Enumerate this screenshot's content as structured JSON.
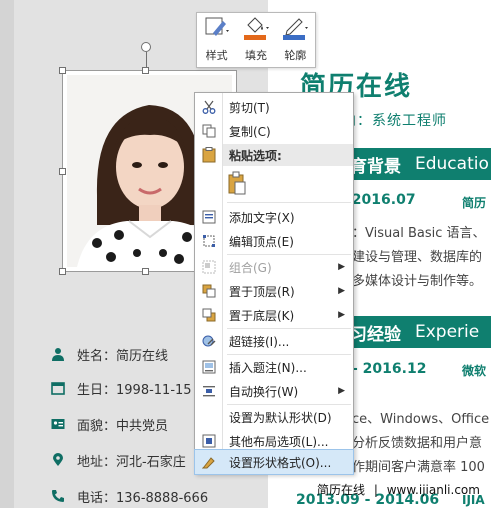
{
  "toolbar": {
    "style_label": "样式",
    "fill_label": "填充",
    "outline_label": "轮廓"
  },
  "context_menu": {
    "cut": "剪切(T)",
    "copy": "复制(C)",
    "paste_options": "粘贴选项:",
    "add_text": "添加文字(X)",
    "edit_points": "编辑顶点(E)",
    "group": "组合(G)",
    "bring_to_front": "置于顶层(R)",
    "send_to_back": "置于底层(K)",
    "hyperlink": "超链接(I)...",
    "insert_caption": "插入题注(N)...",
    "wrap_text": "自动换行(W)",
    "set_default_shape": "设置为默认形状(D)",
    "more_layout": "其他布局选项(L)...",
    "format_shape": "设置形状格式(O)..."
  },
  "resume": {
    "name": "姓名：简历在线",
    "birthday": "生日：1998-11-15",
    "politics": "面貌：中共党员",
    "address": "地址：河北-石家庄",
    "phone": "电话：136-8888-666",
    "title": "简历在线",
    "intent": "向：系统工程师",
    "edu_heading": "育背景",
    "edu_heading_en": "Educatio",
    "edu_date": "-2016.07",
    "edu_side": "简历",
    "edu_line1": "：Visual Basic 语言、",
    "edu_line2": "建设与管理、数据库的",
    "edu_line3": "多媒体设计与制作等。",
    "work_heading": "习经验",
    "work_heading_en": "Experie",
    "work_date": "- 2016.12",
    "work_side": "微软",
    "work_line1": "ce、Windows、Office",
    "work_line2": "分析反馈数据和用户意",
    "work_line3": "作期间客户满意率 100",
    "next_date": "2013.09 - 2014.06",
    "next_side": "IJIA"
  },
  "watermark": {
    "brand": "简历在线",
    "separator": "|",
    "url": "www.ijianli.com"
  },
  "colors": {
    "accent": "#0f7f6f",
    "highlight": "#d5e8f8"
  }
}
